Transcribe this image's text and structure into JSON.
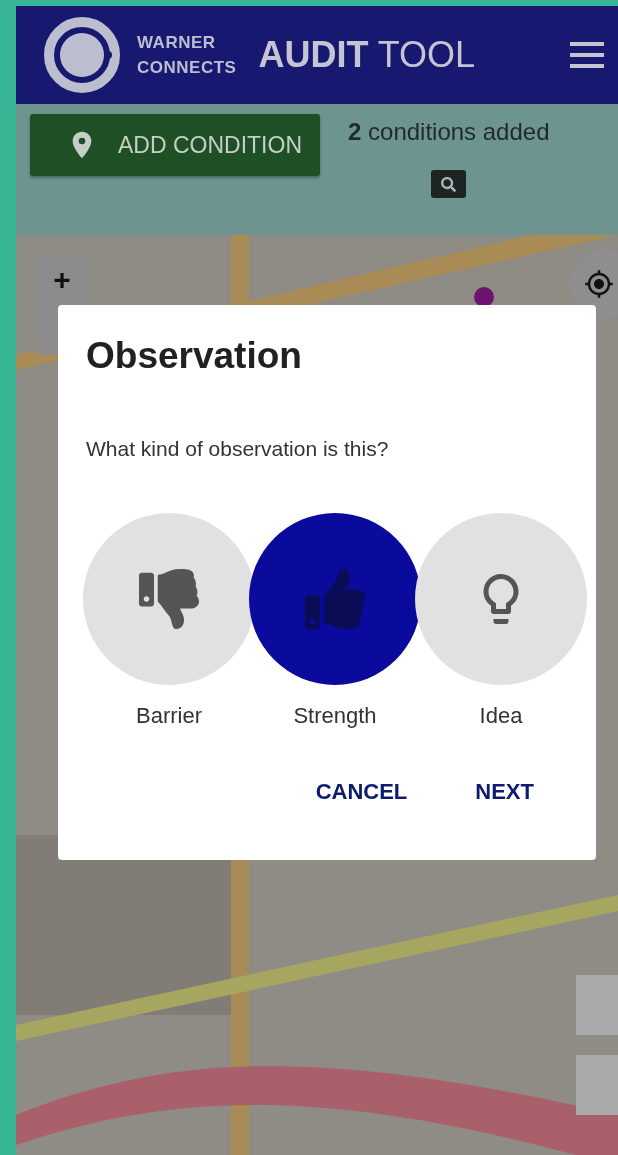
{
  "header": {
    "logo_lines": [
      "WARNER",
      "CONNECTS"
    ],
    "title_bold": "AUDIT",
    "title_light": "TOOL"
  },
  "toolbar": {
    "add_button": "ADD CONDITION",
    "status": "**2** conditions added"
  },
  "map": {
    "kind": "picture",
    "zoom_in": "+"
  },
  "dialog": {
    "title": "Observation",
    "question": "What kind of observation is this?",
    "options": [
      {
        "label": "Barrier",
        "kind": "barrier",
        "selected": false
      },
      {
        "label": "Strength",
        "kind": "strength",
        "selected": true
      },
      {
        "label": "Idea",
        "kind": "idea",
        "selected": false
      }
    ],
    "actions": [
      "CANCEL",
      "NEXT"
    ]
  }
}
